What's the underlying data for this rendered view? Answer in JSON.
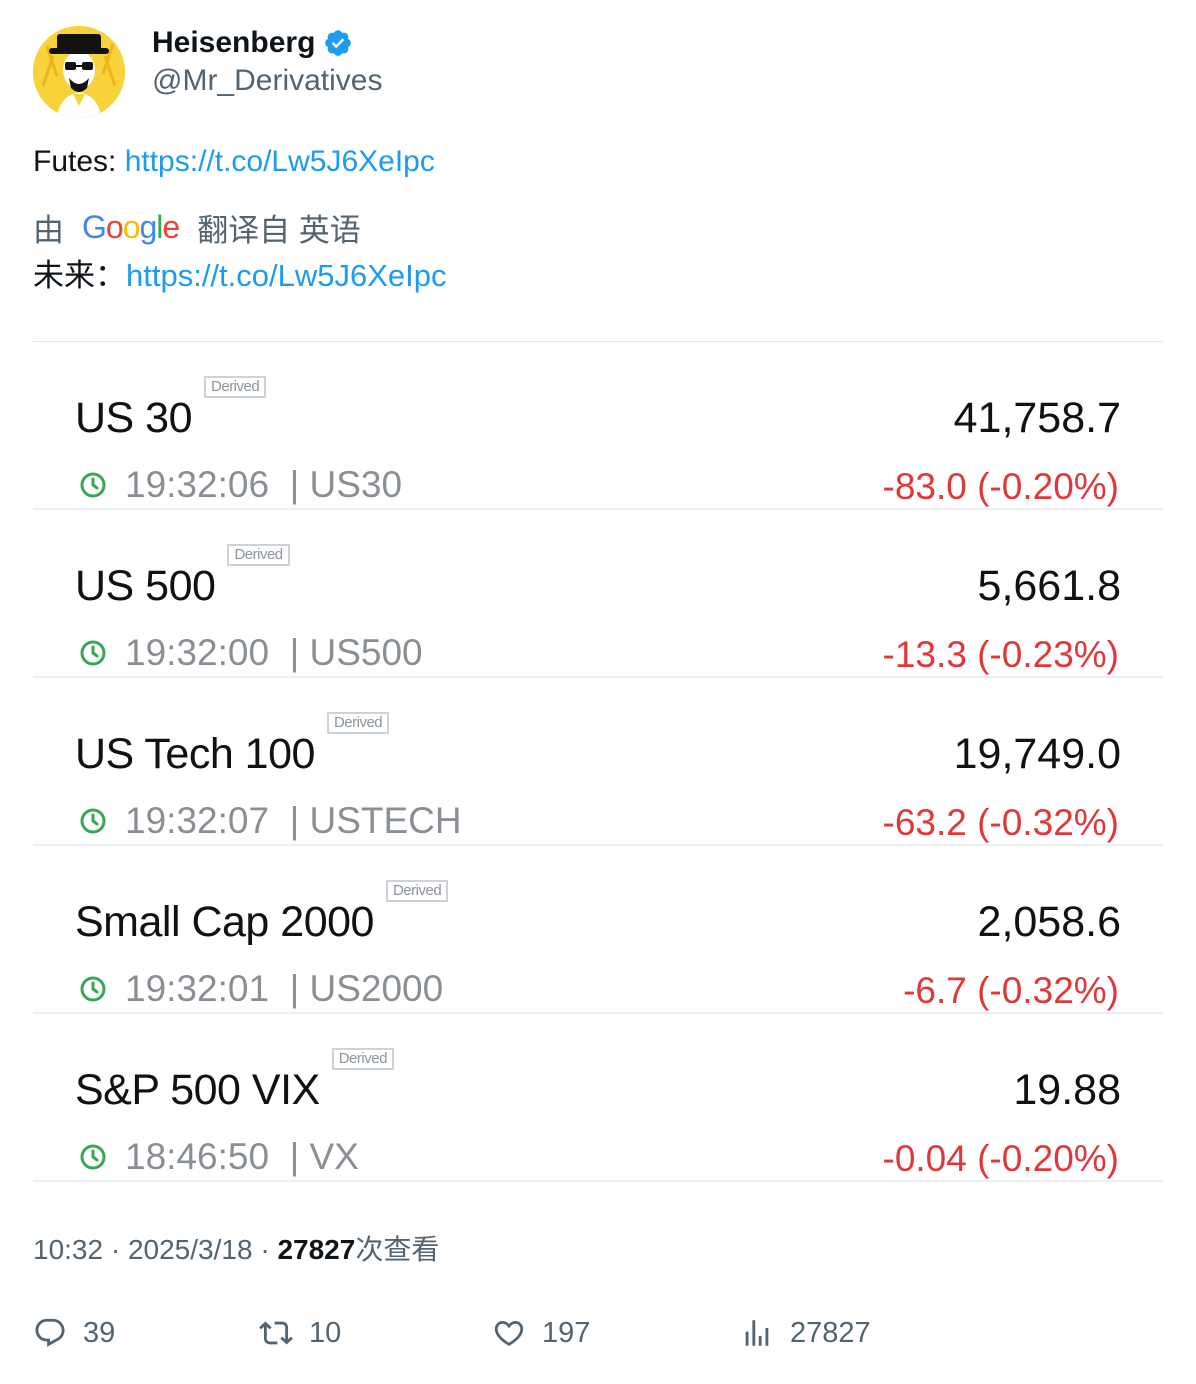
{
  "author": {
    "display_name": "Heisenberg",
    "handle": "@Mr_Derivatives",
    "verified": true,
    "avatar_icon": "heisenberg-avatar-icon"
  },
  "tweet": {
    "text_prefix": "Futes: ",
    "link": "https://t.co/Lw5J6XeIpc"
  },
  "translation": {
    "by_label": "由",
    "provider": "Google",
    "translated_from": "翻译自 英语",
    "text_prefix": "未来：",
    "link": "https://t.co/Lw5J6XeIpc"
  },
  "quotes": [
    {
      "name": "US 30",
      "tag": "Derived",
      "time": "19:32:06",
      "symbol": "| US30",
      "price": "41,758.7",
      "change": "-83.0 (-0.20%)"
    },
    {
      "name": "US 500",
      "tag": "Derived",
      "time": "19:32:00",
      "symbol": "| US500",
      "price": "5,661.8",
      "change": "-13.3 (-0.23%)"
    },
    {
      "name": "US Tech 100",
      "tag": "Derived",
      "time": "19:32:07",
      "symbol": "| USTECH",
      "price": "19,749.0",
      "change": "-63.2 (-0.32%)"
    },
    {
      "name": "Small Cap 2000",
      "tag": "Derived",
      "time": "19:32:01",
      "symbol": "| US2000",
      "price": "2,058.6",
      "change": "-6.7 (-0.32%)"
    },
    {
      "name": "S&P 500 VIX",
      "tag": "Derived",
      "time": "18:46:50",
      "symbol": "| VX",
      "price": "19.88",
      "change": "-0.04 (-0.20%)"
    }
  ],
  "meta": {
    "time": "10:32",
    "sep": "·",
    "date": "2025/3/18",
    "views_count": "27827",
    "views_label": "次查看"
  },
  "actions": {
    "replies": "39",
    "retweets": "10",
    "likes": "197",
    "views": "27827"
  },
  "colors": {
    "link": "#1d9bf0",
    "negative_change": "#e0383a",
    "clock": "#3aa655",
    "muted": "#536471"
  }
}
